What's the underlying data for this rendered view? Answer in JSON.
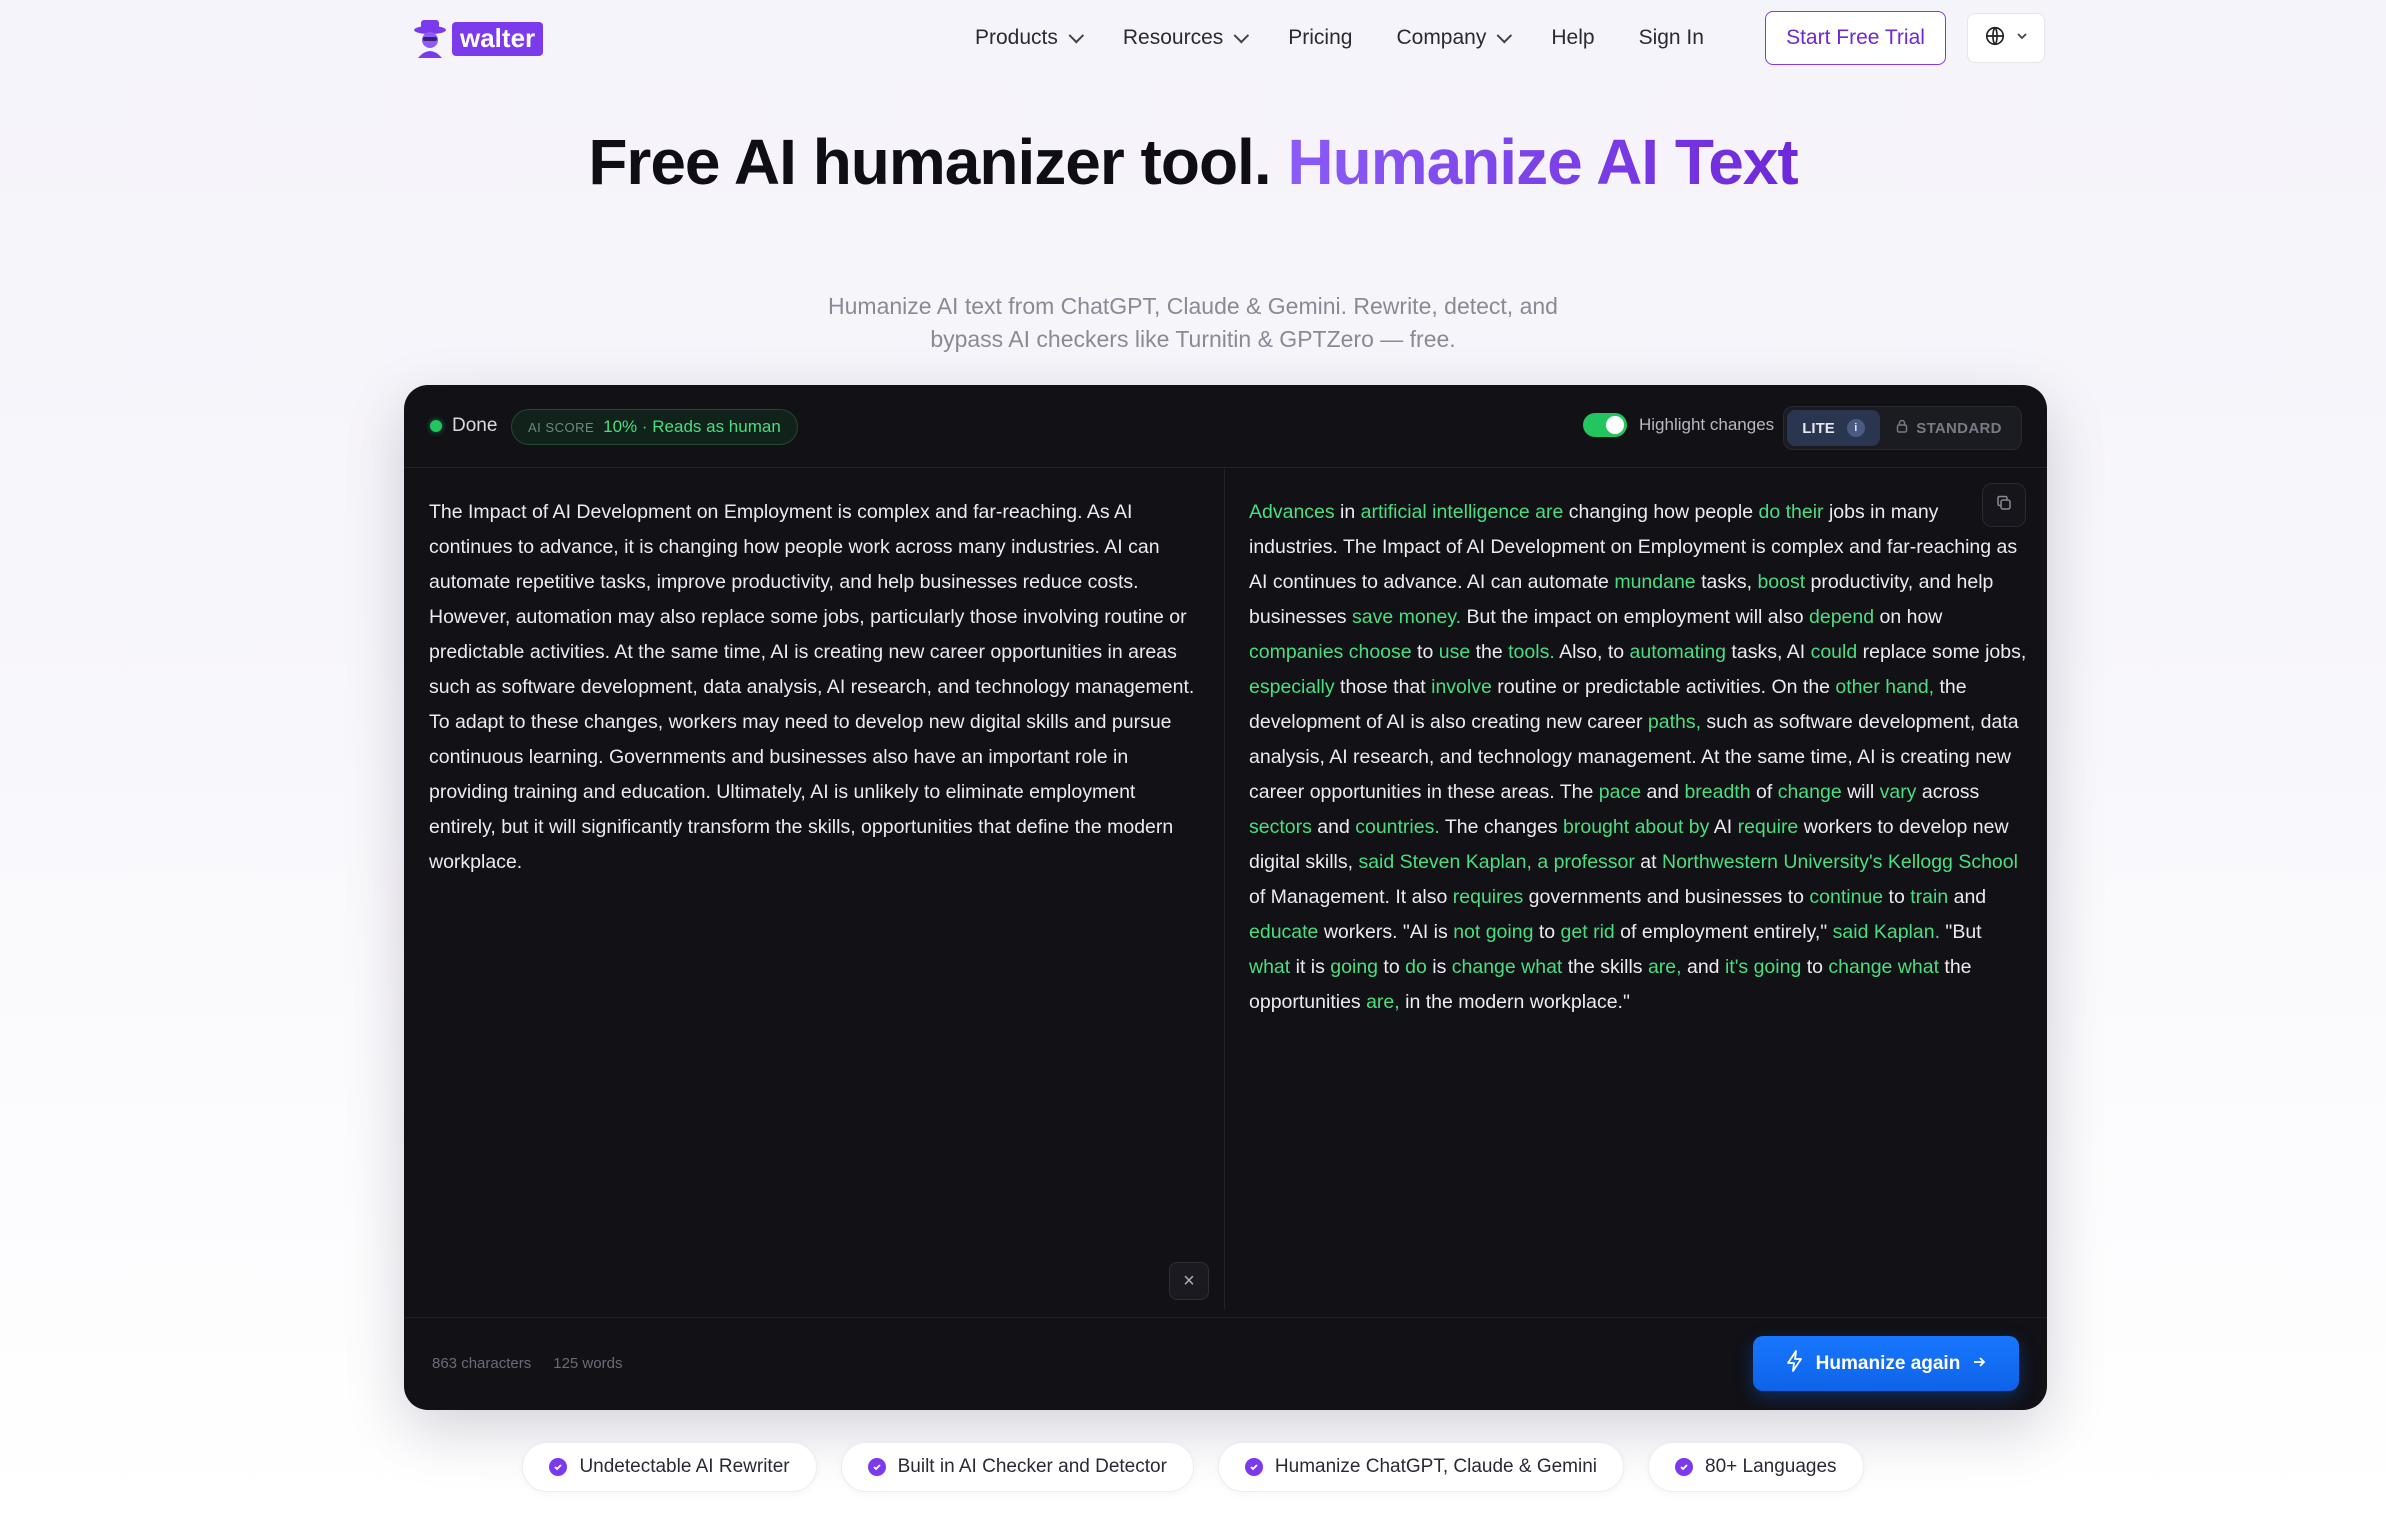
{
  "nav": {
    "logo_text": "walter",
    "products": "Products",
    "resources": "Resources",
    "pricing": "Pricing",
    "company": "Company",
    "help": "Help",
    "signin": "Sign In",
    "trial": "Start Free Trial"
  },
  "hero": {
    "title_plain": "Free AI humanizer tool.",
    "title_accent": "Humanize AI Text",
    "subtitle": "Humanize AI text from ChatGPT, Claude & Gemini. Rewrite, detect, and bypass AI checkers like Turnitin & GPTZero — free."
  },
  "panel": {
    "status": "Done",
    "score_label": "AI SCORE",
    "score_value": "10% · Reads as human",
    "highlight_label": "Highlight changes",
    "mode_lite": "LITE",
    "mode_standard": "STANDARD",
    "input_text": "The Impact of AI Development on Employment is complex and far-reaching. As AI continues to advance, it is changing how people work across many industries. AI can automate repetitive tasks, improve productivity, and help businesses reduce costs. However, automation may also replace some jobs, particularly those involving routine or predictable activities. At the same time, AI is creating new career opportunities in areas such as software development, data analysis, AI research, and technology management. To adapt to these changes, workers may need to develop new digital skills and pursue continuous learning. Governments and businesses also have an important role in providing training and education. Ultimately, AI is unlikely to eliminate employment entirely, but it will significantly transform the skills, opportunities that define the modern workplace.",
    "output_segments": [
      {
        "t": "Advances",
        "c": true
      },
      {
        "t": " in ",
        "c": false
      },
      {
        "t": "artificial intelligence are",
        "c": true
      },
      {
        "t": " changing how people ",
        "c": false
      },
      {
        "t": "do their",
        "c": true
      },
      {
        "t": " jobs in many industries. The Impact of AI Development on Employment is complex and far-reaching as AI continues to advance. AI can automate ",
        "c": false
      },
      {
        "t": "mundane",
        "c": true
      },
      {
        "t": " tasks, ",
        "c": false
      },
      {
        "t": "boost",
        "c": true
      },
      {
        "t": " productivity, and help businesses ",
        "c": false
      },
      {
        "t": "save money.",
        "c": true
      },
      {
        "t": " But the impact on employment will also ",
        "c": false
      },
      {
        "t": "depend",
        "c": true
      },
      {
        "t": " on how ",
        "c": false
      },
      {
        "t": "companies choose",
        "c": true
      },
      {
        "t": " to ",
        "c": false
      },
      {
        "t": "use",
        "c": true
      },
      {
        "t": " the ",
        "c": false
      },
      {
        "t": "tools.",
        "c": true
      },
      {
        "t": " Also, to ",
        "c": false
      },
      {
        "t": "automating",
        "c": true
      },
      {
        "t": " tasks, AI ",
        "c": false
      },
      {
        "t": "could",
        "c": true
      },
      {
        "t": " replace some jobs, ",
        "c": false
      },
      {
        "t": "especially",
        "c": true
      },
      {
        "t": " those that ",
        "c": false
      },
      {
        "t": "involve",
        "c": true
      },
      {
        "t": " routine or predictable activities. On the ",
        "c": false
      },
      {
        "t": "other hand,",
        "c": true
      },
      {
        "t": " the development of AI is also creating new career ",
        "c": false
      },
      {
        "t": "paths,",
        "c": true
      },
      {
        "t": " such as software development, data analysis, AI research, and technology management. At the same time, AI is creating new career opportunities in these areas. The ",
        "c": false
      },
      {
        "t": "pace",
        "c": true
      },
      {
        "t": " and ",
        "c": false
      },
      {
        "t": "breadth",
        "c": true
      },
      {
        "t": " of ",
        "c": false
      },
      {
        "t": "change",
        "c": true
      },
      {
        "t": " will ",
        "c": false
      },
      {
        "t": "vary",
        "c": true
      },
      {
        "t": " across ",
        "c": false
      },
      {
        "t": "sectors",
        "c": true
      },
      {
        "t": " and ",
        "c": false
      },
      {
        "t": "countries.",
        "c": true
      },
      {
        "t": " The changes ",
        "c": false
      },
      {
        "t": "brought about by",
        "c": true
      },
      {
        "t": " AI ",
        "c": false
      },
      {
        "t": "require",
        "c": true
      },
      {
        "t": " workers to develop new digital skills, ",
        "c": false
      },
      {
        "t": "said Steven Kaplan, a professor",
        "c": true
      },
      {
        "t": " at ",
        "c": false
      },
      {
        "t": "Northwestern University's Kellogg School",
        "c": true
      },
      {
        "t": " of Management. It also ",
        "c": false
      },
      {
        "t": "requires",
        "c": true
      },
      {
        "t": " governments and businesses to ",
        "c": false
      },
      {
        "t": "continue",
        "c": true
      },
      {
        "t": " to ",
        "c": false
      },
      {
        "t": "train",
        "c": true
      },
      {
        "t": " and ",
        "c": false
      },
      {
        "t": "educate",
        "c": true
      },
      {
        "t": " workers. \"AI is ",
        "c": false
      },
      {
        "t": "not going",
        "c": true
      },
      {
        "t": " to ",
        "c": false
      },
      {
        "t": "get rid",
        "c": true
      },
      {
        "t": " of employment entirely,\" ",
        "c": false
      },
      {
        "t": "said Kaplan.",
        "c": true
      },
      {
        "t": " \"But ",
        "c": false
      },
      {
        "t": "what",
        "c": true
      },
      {
        "t": " it is ",
        "c": false
      },
      {
        "t": "going",
        "c": true
      },
      {
        "t": " to ",
        "c": false
      },
      {
        "t": "do",
        "c": true
      },
      {
        "t": " is ",
        "c": false
      },
      {
        "t": "change what",
        "c": true
      },
      {
        "t": " the skills ",
        "c": false
      },
      {
        "t": "are,",
        "c": true
      },
      {
        "t": " and ",
        "c": false
      },
      {
        "t": "it's going",
        "c": true
      },
      {
        "t": " to ",
        "c": false
      },
      {
        "t": "change what",
        "c": true
      },
      {
        "t": " the opportunities ",
        "c": false
      },
      {
        "t": "are,",
        "c": true
      },
      {
        "t": " in the modern workplace.\"",
        "c": false
      }
    ],
    "chars": "863 characters",
    "words": "125 words",
    "humanize_btn": "Humanize again"
  },
  "features": [
    "Undetectable AI Rewriter",
    "Built in AI Checker and Detector",
    "Humanize ChatGPT, Claude & Gemini",
    "80+ Languages"
  ],
  "colors": {
    "accent": "#7c3aed",
    "highlight": "#4ade80",
    "primary_btn": "#1877ff"
  }
}
